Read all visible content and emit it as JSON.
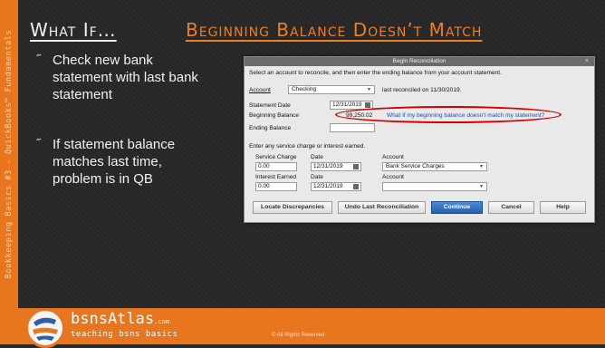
{
  "slide": {
    "title_left": "What If…",
    "title_right": "Beginning Balance Doesn’t Match",
    "sidebar_text": "Bookkeeping Basics #3 - QuickBooks™ Fundamentals",
    "bullets": [
      {
        "mark": "˝",
        "text": "Check new bank statement with last bank statement"
      },
      {
        "mark": "˝",
        "text": "If statement balance matches last time, problem is in QB"
      }
    ],
    "brand": "bsnsAtlas",
    "brand_suffix": ".com",
    "brand_tagline": "teaching bsns basics",
    "copyright": "© All Rights Reserved"
  },
  "dialog": {
    "title": "Begin Reconciliation",
    "close": "×",
    "instructions": "Select an account to reconcile, and then enter the ending balance from your account statement.",
    "account_label": "Account",
    "account_value": "Checking",
    "last_reconciled": "last reconciled on 11/30/2019.",
    "statement_date_label": "Statement Date",
    "statement_date_value": "12/31/2019",
    "beginning_balance_label": "Beginning Balance",
    "beginning_balance_value": "99,250.02",
    "mismatch_link": "What if my beginning balance doesn't match my statement?",
    "ending_balance_label": "Ending Balance",
    "ending_balance_value": "",
    "service_prompt": "Enter any service charge or interest earned.",
    "service_charge_label": "Service Charge",
    "date_label_1": "Date",
    "account_label_1": "Account",
    "service_charge_value": "0.00",
    "service_date_value": "12/31/2019",
    "service_account_value": "Bank Service Charges",
    "interest_label": "Interest Earned",
    "date_label_2": "Date",
    "account_label_2": "Account",
    "interest_value": "0.00",
    "interest_date_value": "12/31/2019",
    "interest_account_value": "",
    "buttons": {
      "locate": "Locate Discrepancies",
      "undo": "Undo Last Reconciliation",
      "continue": "Continue",
      "cancel": "Cancel",
      "help": "Help"
    }
  },
  "colors": {
    "accent": "#e8761e",
    "title_orange": "#ef7d22",
    "highlight_ellipse": "#d40000",
    "link": "#1a4fb5"
  }
}
